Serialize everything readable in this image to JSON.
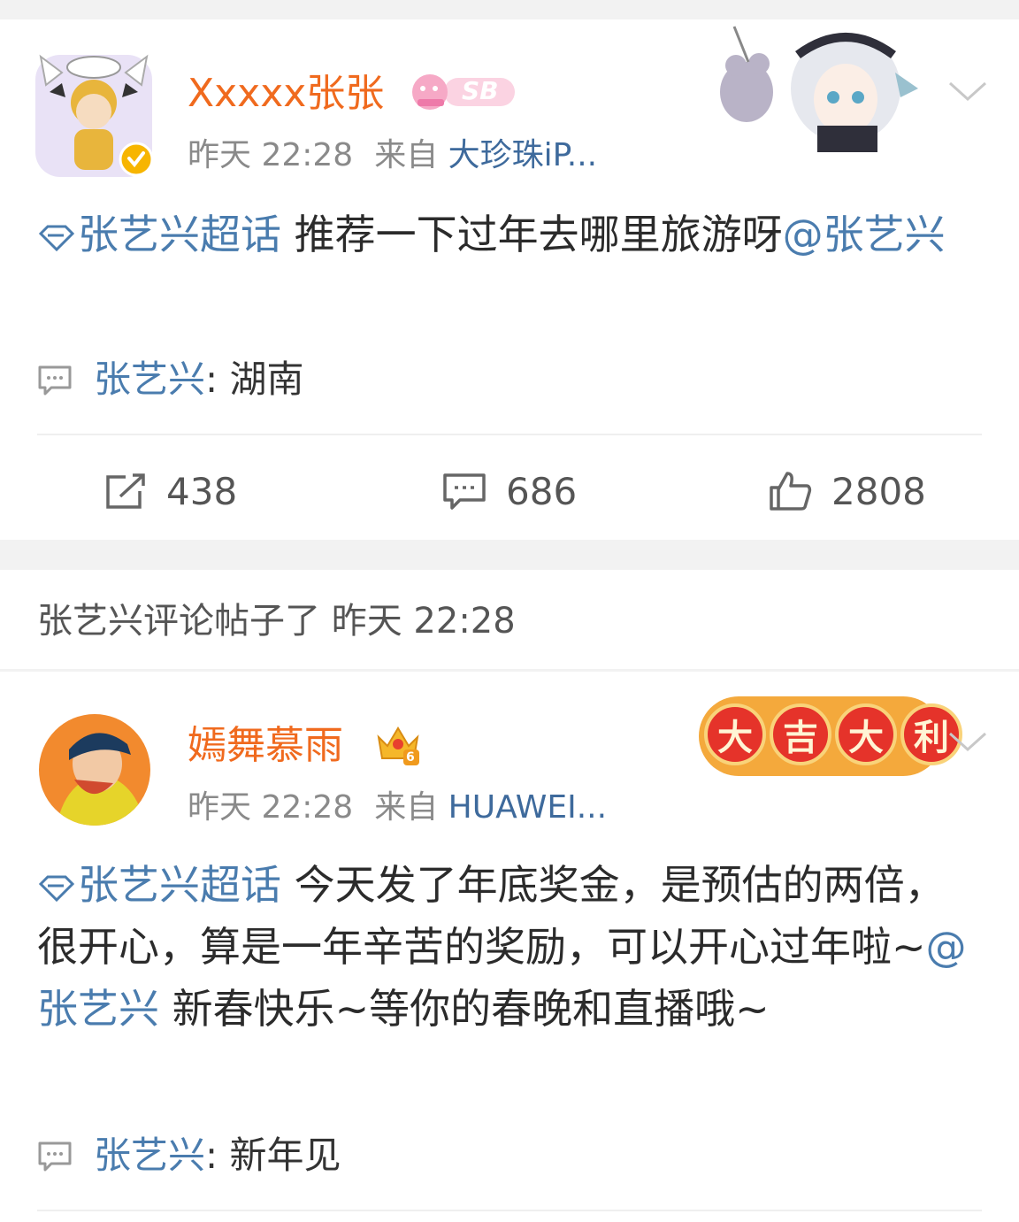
{
  "posts": [
    {
      "username": "Xxxxx张张",
      "badge_text": "SB",
      "time": "昨天 22:28",
      "from_label": "来自",
      "source": "大珍珠iP...",
      "topic": "张艺兴超话",
      "text_body": " 推荐一下过年去哪里旅游呀",
      "mention": "@张艺兴",
      "text_after": "",
      "comment_author": "张艺兴",
      "comment_colon": ":",
      "comment_text": "湖南",
      "reposts": "438",
      "comments": "686",
      "likes": "2808"
    },
    {
      "username": "嫣舞慕雨",
      "level_badge": "6",
      "decoration": [
        "大",
        "吉",
        "大",
        "利"
      ],
      "time": "昨天 22:28",
      "from_label": "来自",
      "source": "HUAWEI...",
      "topic": "张艺兴超话",
      "text_body": " 今天发了年底奖金，是预估的两倍，很开心，算是一年辛苦的奖励，可以开心过年啦~",
      "mention": "@张艺兴",
      "text_after": " 新春快乐~等你的春晚和直播哦~",
      "comment_author": "张艺兴",
      "comment_colon": ":",
      "comment_text": "新年见"
    }
  ],
  "notice": {
    "text": "张艺兴评论帖子了 昨天 22:28"
  },
  "colors": {
    "username": "#f06a1e",
    "link": "#4a7cae",
    "meta": "#8a8a8a",
    "separator": "#f2f2f2"
  },
  "icons": [
    "verified-badge-icon",
    "chevron-down-icon",
    "comment-bubble-icon",
    "repost-icon",
    "like-icon",
    "topic-diamond-icon",
    "crown-badge-icon"
  ]
}
